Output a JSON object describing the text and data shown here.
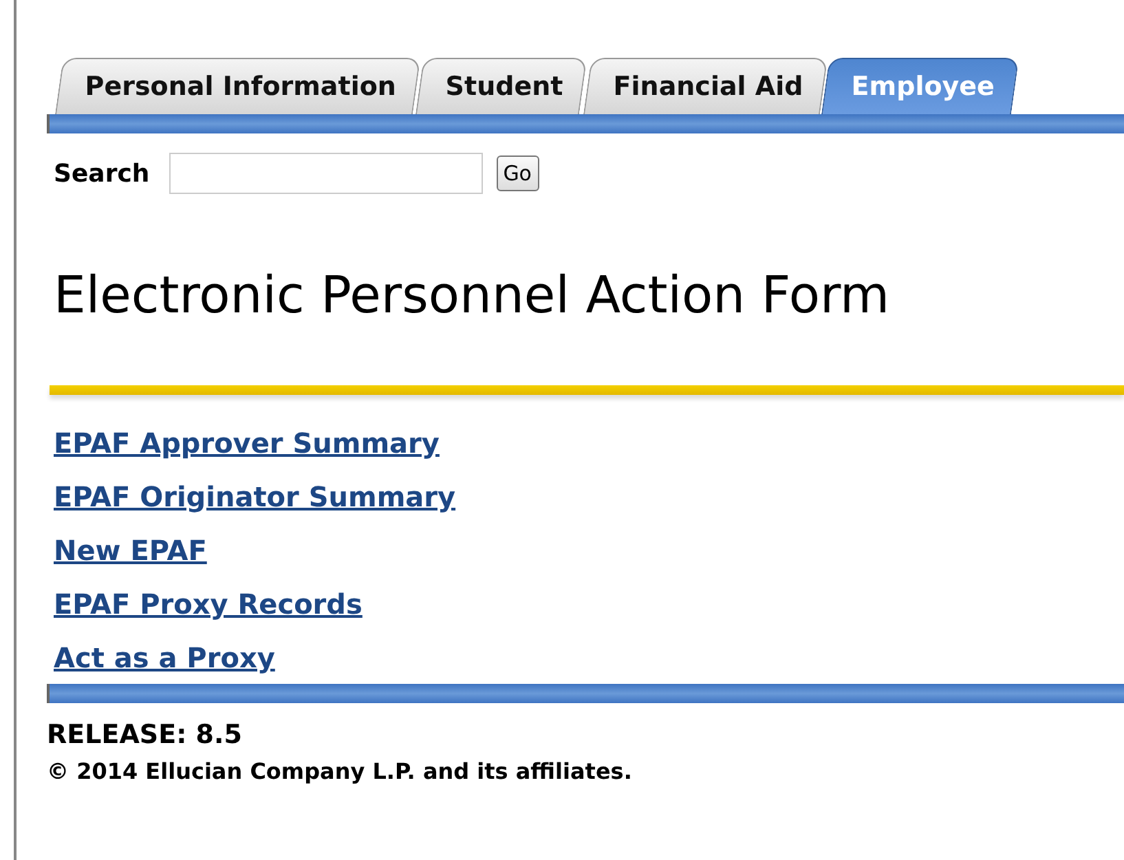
{
  "tabs": [
    {
      "label": "Personal Information",
      "selected": false
    },
    {
      "label": "Student",
      "selected": false
    },
    {
      "label": "Financial Aid",
      "selected": false
    },
    {
      "label": "Employee",
      "selected": true
    }
  ],
  "search": {
    "label": "Search",
    "button": "Go"
  },
  "heading": "Electronic Personnel Action Form",
  "links": [
    "EPAF Approver Summary",
    "EPAF Originator Summary",
    "New EPAF",
    "EPAF Proxy Records",
    "Act as a Proxy"
  ],
  "footer": {
    "release": "RELEASE: 8.5",
    "copyright": "© 2014 Ellucian Company L.P. and its affiliates."
  }
}
